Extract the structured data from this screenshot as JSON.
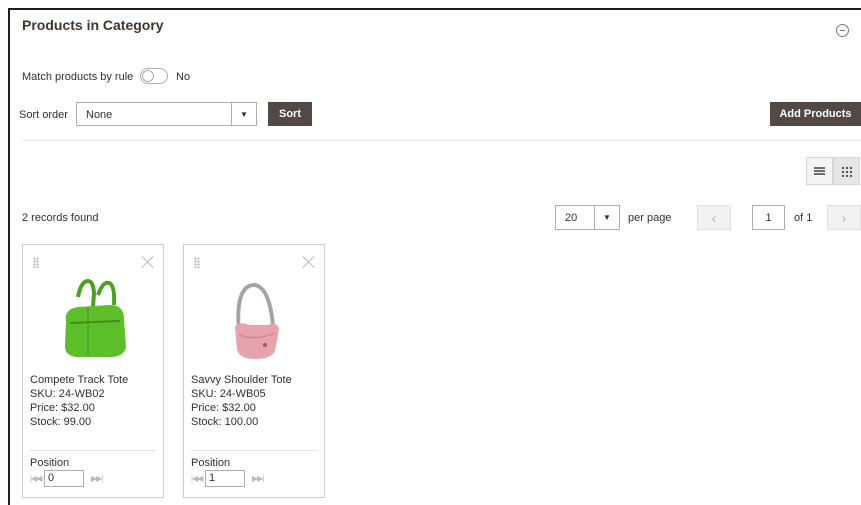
{
  "section": {
    "title": "Products in Category"
  },
  "match_rule": {
    "label": "Match products by rule",
    "state": "No"
  },
  "sort": {
    "label": "Sort order",
    "selected": "None",
    "button": "Sort"
  },
  "add_products_button": "Add Products",
  "view_modes": [
    "list-icon",
    "grid-icon"
  ],
  "records_found": "2 records found",
  "pagination": {
    "per_page_value": "20",
    "per_page_label": "per page",
    "prev": "‹",
    "page": "1",
    "of": "of 1",
    "next": "›"
  },
  "products": [
    {
      "name": "Compete Track Tote",
      "sku": "SKU: 24-WB02",
      "price": "Price: $32.00",
      "stock": "Stock: 99.00",
      "position_label": "Position",
      "position": "0",
      "image_color": "#5cbf2a"
    },
    {
      "name": "Savvy Shoulder Tote",
      "sku": "SKU: 24-WB05",
      "price": "Price: $32.00",
      "stock": "Stock: 100.00",
      "position_label": "Position",
      "position": "1",
      "image_color": "#e6a3ad"
    }
  ],
  "colors": {
    "button_dark": "#514943",
    "title": "#41362f"
  }
}
